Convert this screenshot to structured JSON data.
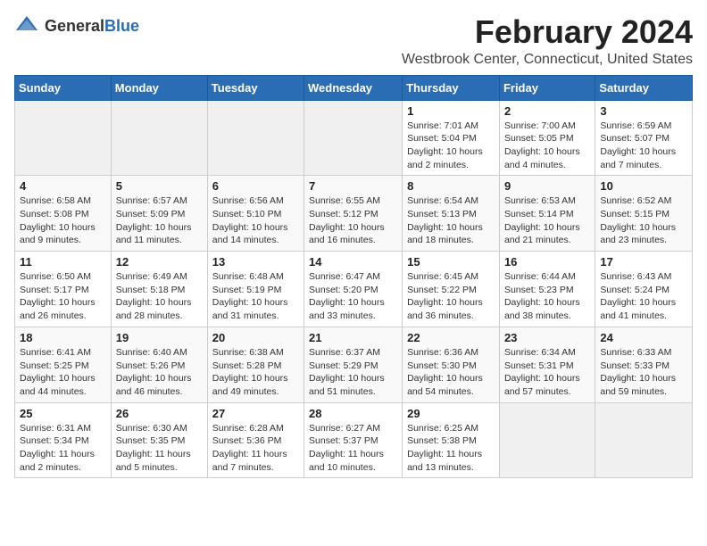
{
  "logo": {
    "general": "General",
    "blue": "Blue"
  },
  "title": "February 2024",
  "location": "Westbrook Center, Connecticut, United States",
  "days_of_week": [
    "Sunday",
    "Monday",
    "Tuesday",
    "Wednesday",
    "Thursday",
    "Friday",
    "Saturday"
  ],
  "weeks": [
    [
      {
        "day": "",
        "info": ""
      },
      {
        "day": "",
        "info": ""
      },
      {
        "day": "",
        "info": ""
      },
      {
        "day": "",
        "info": ""
      },
      {
        "day": "1",
        "info": "Sunrise: 7:01 AM\nSunset: 5:04 PM\nDaylight: 10 hours\nand 2 minutes."
      },
      {
        "day": "2",
        "info": "Sunrise: 7:00 AM\nSunset: 5:05 PM\nDaylight: 10 hours\nand 4 minutes."
      },
      {
        "day": "3",
        "info": "Sunrise: 6:59 AM\nSunset: 5:07 PM\nDaylight: 10 hours\nand 7 minutes."
      }
    ],
    [
      {
        "day": "4",
        "info": "Sunrise: 6:58 AM\nSunset: 5:08 PM\nDaylight: 10 hours\nand 9 minutes."
      },
      {
        "day": "5",
        "info": "Sunrise: 6:57 AM\nSunset: 5:09 PM\nDaylight: 10 hours\nand 11 minutes."
      },
      {
        "day": "6",
        "info": "Sunrise: 6:56 AM\nSunset: 5:10 PM\nDaylight: 10 hours\nand 14 minutes."
      },
      {
        "day": "7",
        "info": "Sunrise: 6:55 AM\nSunset: 5:12 PM\nDaylight: 10 hours\nand 16 minutes."
      },
      {
        "day": "8",
        "info": "Sunrise: 6:54 AM\nSunset: 5:13 PM\nDaylight: 10 hours\nand 18 minutes."
      },
      {
        "day": "9",
        "info": "Sunrise: 6:53 AM\nSunset: 5:14 PM\nDaylight: 10 hours\nand 21 minutes."
      },
      {
        "day": "10",
        "info": "Sunrise: 6:52 AM\nSunset: 5:15 PM\nDaylight: 10 hours\nand 23 minutes."
      }
    ],
    [
      {
        "day": "11",
        "info": "Sunrise: 6:50 AM\nSunset: 5:17 PM\nDaylight: 10 hours\nand 26 minutes."
      },
      {
        "day": "12",
        "info": "Sunrise: 6:49 AM\nSunset: 5:18 PM\nDaylight: 10 hours\nand 28 minutes."
      },
      {
        "day": "13",
        "info": "Sunrise: 6:48 AM\nSunset: 5:19 PM\nDaylight: 10 hours\nand 31 minutes."
      },
      {
        "day": "14",
        "info": "Sunrise: 6:47 AM\nSunset: 5:20 PM\nDaylight: 10 hours\nand 33 minutes."
      },
      {
        "day": "15",
        "info": "Sunrise: 6:45 AM\nSunset: 5:22 PM\nDaylight: 10 hours\nand 36 minutes."
      },
      {
        "day": "16",
        "info": "Sunrise: 6:44 AM\nSunset: 5:23 PM\nDaylight: 10 hours\nand 38 minutes."
      },
      {
        "day": "17",
        "info": "Sunrise: 6:43 AM\nSunset: 5:24 PM\nDaylight: 10 hours\nand 41 minutes."
      }
    ],
    [
      {
        "day": "18",
        "info": "Sunrise: 6:41 AM\nSunset: 5:25 PM\nDaylight: 10 hours\nand 44 minutes."
      },
      {
        "day": "19",
        "info": "Sunrise: 6:40 AM\nSunset: 5:26 PM\nDaylight: 10 hours\nand 46 minutes."
      },
      {
        "day": "20",
        "info": "Sunrise: 6:38 AM\nSunset: 5:28 PM\nDaylight: 10 hours\nand 49 minutes."
      },
      {
        "day": "21",
        "info": "Sunrise: 6:37 AM\nSunset: 5:29 PM\nDaylight: 10 hours\nand 51 minutes."
      },
      {
        "day": "22",
        "info": "Sunrise: 6:36 AM\nSunset: 5:30 PM\nDaylight: 10 hours\nand 54 minutes."
      },
      {
        "day": "23",
        "info": "Sunrise: 6:34 AM\nSunset: 5:31 PM\nDaylight: 10 hours\nand 57 minutes."
      },
      {
        "day": "24",
        "info": "Sunrise: 6:33 AM\nSunset: 5:33 PM\nDaylight: 10 hours\nand 59 minutes."
      }
    ],
    [
      {
        "day": "25",
        "info": "Sunrise: 6:31 AM\nSunset: 5:34 PM\nDaylight: 11 hours\nand 2 minutes."
      },
      {
        "day": "26",
        "info": "Sunrise: 6:30 AM\nSunset: 5:35 PM\nDaylight: 11 hours\nand 5 minutes."
      },
      {
        "day": "27",
        "info": "Sunrise: 6:28 AM\nSunset: 5:36 PM\nDaylight: 11 hours\nand 7 minutes."
      },
      {
        "day": "28",
        "info": "Sunrise: 6:27 AM\nSunset: 5:37 PM\nDaylight: 11 hours\nand 10 minutes."
      },
      {
        "day": "29",
        "info": "Sunrise: 6:25 AM\nSunset: 5:38 PM\nDaylight: 11 hours\nand 13 minutes."
      },
      {
        "day": "",
        "info": ""
      },
      {
        "day": "",
        "info": ""
      }
    ]
  ]
}
